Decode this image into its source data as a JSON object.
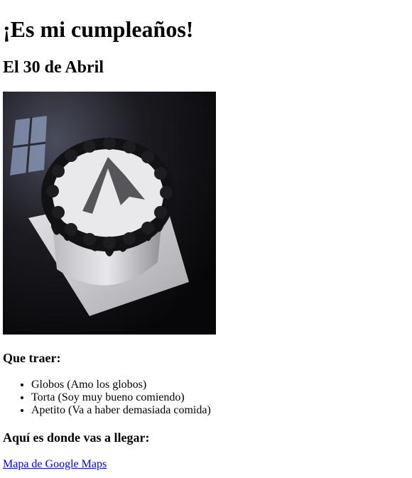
{
  "page": {
    "title": "¡Es mi cumpleaños!",
    "date": "El 30 de Abril",
    "photo": {
      "icon": "birthday-cake-photo"
    },
    "bring_heading": "Que traer:",
    "bring_items": [
      "Globos (Amo los globos)",
      "Torta (Soy muy bueno comiendo)",
      "Apetito (Va a haber demasiada comida)"
    ],
    "location_heading": "Aquí es donde vas a llegar:",
    "map_link": "Mapa de Google Maps",
    "colors": {
      "link": "#0000ee",
      "text": "#000000",
      "background": "#ffffff"
    }
  }
}
